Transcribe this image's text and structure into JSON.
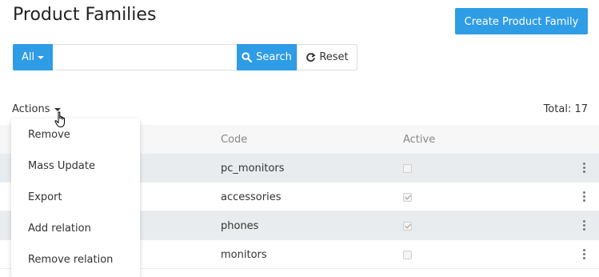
{
  "page": {
    "title": "Product Families"
  },
  "toolbar": {
    "create_label": "Create Product Family"
  },
  "search": {
    "filter_label": "All",
    "value": "",
    "placeholder": "",
    "search_label": "Search",
    "reset_label": "Reset"
  },
  "actions": {
    "label": "Actions",
    "menu": [
      "Remove",
      "Mass Update",
      "Export",
      "Add relation",
      "Remove relation"
    ]
  },
  "total": {
    "label": "Total: 17"
  },
  "table": {
    "columns": [
      "Code",
      "Active"
    ],
    "rows": [
      {
        "code": "pc_monitors",
        "active": false
      },
      {
        "code": "accessories",
        "active": true
      },
      {
        "code": "phones",
        "active": true
      },
      {
        "code": "monitors",
        "active": false
      }
    ]
  },
  "colors": {
    "accent": "#2f9ce6",
    "row_alt": "#e9ecee",
    "header_bg": "#f7f7f7"
  },
  "icons": {
    "search": "search-icon",
    "reset": "refresh-icon",
    "row_menu": "kebab-icon",
    "cursor": "hand-pointer-icon"
  }
}
